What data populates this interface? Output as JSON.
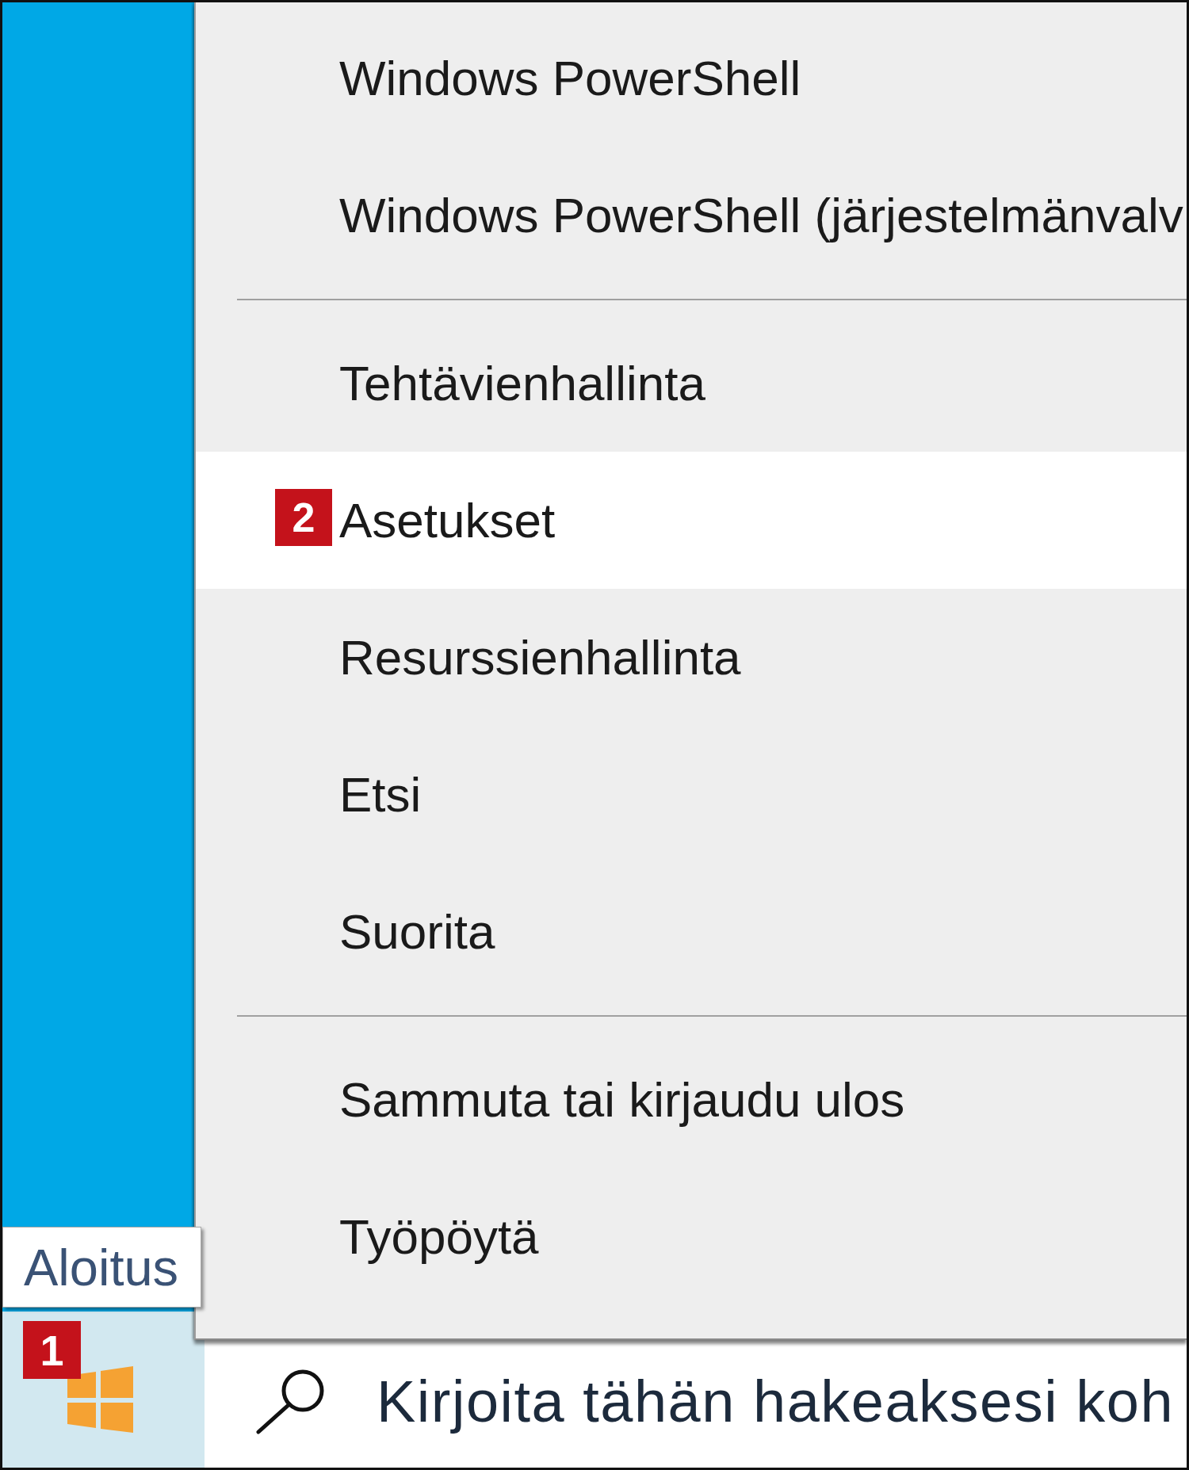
{
  "menu": {
    "items": [
      {
        "kind": "item",
        "label": "Windows PowerShell",
        "selected": false
      },
      {
        "kind": "item",
        "label": "Windows PowerShell (järjestelmänvalv",
        "selected": false
      },
      {
        "kind": "separator"
      },
      {
        "kind": "item",
        "label": "Tehtävienhallinta",
        "selected": false
      },
      {
        "kind": "item",
        "label": "Asetukset",
        "selected": true,
        "badge": "2"
      },
      {
        "kind": "item",
        "label": "Resurssienhallinta",
        "selected": false
      },
      {
        "kind": "item",
        "label": "Etsi",
        "selected": false
      },
      {
        "kind": "item",
        "label": "Suorita",
        "selected": false
      },
      {
        "kind": "separator"
      },
      {
        "kind": "item",
        "label": "Sammuta tai kirjaudu ulos",
        "selected": false
      },
      {
        "kind": "item",
        "label": "Työpöytä",
        "selected": false
      }
    ]
  },
  "tooltip": {
    "text": "Aloitus"
  },
  "taskbar": {
    "start_button": {
      "badge": "1"
    },
    "search": {
      "placeholder": "Kirjoita tähän hakeaksesi koh"
    }
  }
}
